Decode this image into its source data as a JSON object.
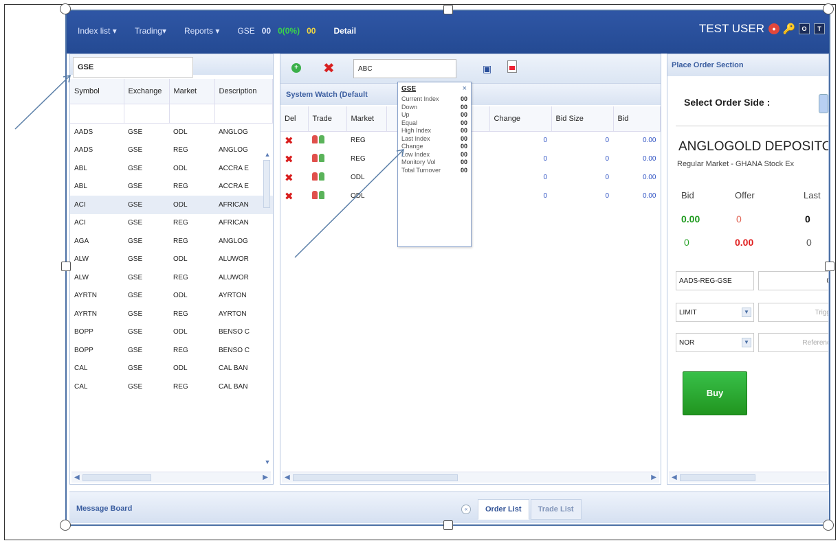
{
  "nav": {
    "index_list": "Index list ▾",
    "trading": "Trading▾",
    "reports": "Reports ▾",
    "gse_label": "GSE",
    "gse_value": "00",
    "gse_change": "0(0%)",
    "gse_extra": "00",
    "detail": "Detail"
  },
  "user": {
    "name": "TEST USER",
    "btn_o": "O",
    "btn_t": "T"
  },
  "symbol_panel": {
    "selected_index": "GSE",
    "columns": [
      "Symbol",
      "Exchange",
      "Market",
      "Description"
    ],
    "rows": [
      [
        "AADS",
        "GSE",
        "ODL",
        "ANGLOG"
      ],
      [
        "AADS",
        "GSE",
        "REG",
        "ANGLOG"
      ],
      [
        "ABL",
        "GSE",
        "ODL",
        "ACCRA E"
      ],
      [
        "ABL",
        "GSE",
        "REG",
        "ACCRA E"
      ],
      [
        "ACI",
        "GSE",
        "ODL",
        "AFRICAN"
      ],
      [
        "ACI",
        "GSE",
        "REG",
        "AFRICAN"
      ],
      [
        "AGA",
        "GSE",
        "REG",
        "ANGLOG"
      ],
      [
        "ALW",
        "GSE",
        "ODL",
        "ALUWOR"
      ],
      [
        "ALW",
        "GSE",
        "REG",
        "ALUWOR"
      ],
      [
        "AYRTN",
        "GSE",
        "ODL",
        "AYRTON"
      ],
      [
        "AYRTN",
        "GSE",
        "REG",
        "AYRTON"
      ],
      [
        "BOPP",
        "GSE",
        "ODL",
        "BENSO C"
      ],
      [
        "BOPP",
        "GSE",
        "REG",
        "BENSO C"
      ],
      [
        "CAL",
        "GSE",
        "ODL",
        "CAL BAN"
      ],
      [
        "CAL",
        "GSE",
        "REG",
        "CAL BAN"
      ]
    ]
  },
  "watch_panel": {
    "input_value": "ABC",
    "title": "System Watch (Default",
    "columns": [
      "Del",
      "Trade",
      "Market",
      "",
      "Change",
      "Bid Size",
      "Bid"
    ],
    "rows": [
      {
        "market": "REG",
        "change": "0",
        "bid_size": "0",
        "bid": "0.00"
      },
      {
        "market": "REG",
        "change": "0",
        "bid_size": "0",
        "bid": "0.00"
      },
      {
        "market": "ODL",
        "change": "0",
        "bid_size": "0",
        "bid": "0.00"
      },
      {
        "market": "ODL",
        "change": "0",
        "bid_size": "0",
        "bid": "0.00"
      }
    ]
  },
  "index_popup": {
    "title": "GSE",
    "close": "×",
    "rows": [
      {
        "label": "Current Index",
        "value": "00"
      },
      {
        "label": "Down",
        "value": "00"
      },
      {
        "label": "Up",
        "value": "00"
      },
      {
        "label": "Equal",
        "value": "00"
      },
      {
        "label": "High Index",
        "value": "00"
      },
      {
        "label": "Last Index",
        "value": "00"
      },
      {
        "label": "Change",
        "value": "00"
      },
      {
        "label": "Low Index",
        "value": "00"
      },
      {
        "label": "Monitory Vol",
        "value": "00"
      },
      {
        "label": "Total Turnover",
        "value": "00"
      }
    ]
  },
  "order_panel": {
    "title": "Place Order Section",
    "select_side": "Select Order Side :",
    "security": "ANGLOGOLD DEPOSITO",
    "security_sub": "Regular Market - GHANA Stock Ex",
    "bid_label": "Bid",
    "offer_label": "Offer",
    "last_label": "Last",
    "bid_val1": "0.00",
    "offer_val1": "0",
    "last_val1": "0",
    "bid_val2": "0",
    "offer_val2": "0.00",
    "last_val2": "0",
    "symbol_field": "AADS-REG-GSE",
    "qty_field": "0",
    "order_type": "LIMIT",
    "trigger_placeholder": "Trigg",
    "validity": "NOR",
    "reference_placeholder": "Referenc",
    "buy": "Buy"
  },
  "bottom": {
    "message_board": "Message Board",
    "tabs": [
      "Order List",
      "Trade List"
    ]
  }
}
